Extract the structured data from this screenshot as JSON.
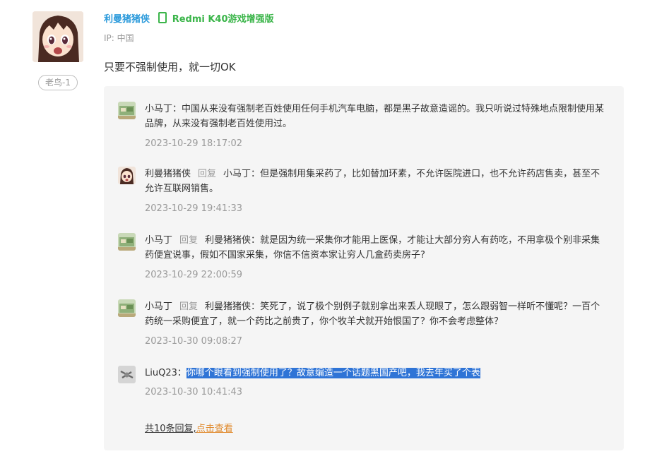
{
  "post": {
    "author": "利曼猪猪侠",
    "device": "Redmi K40游戏增强版",
    "device_icon": "phone-icon",
    "ip": "IP: 中国",
    "level": "老鸟-1",
    "content": "只要不强制使用，就一切OK"
  },
  "replies": [
    {
      "user": "小马丁",
      "separator": "：",
      "reply_word": "",
      "target": "",
      "text": "中国从来没有强制老百姓使用任何手机汽车电脑，都是黑子故意造谣的。我只听说过特殊地点限制使用某品牌，从来没有强制老百姓使用过。",
      "time": "2023-10-29 18:17:02"
    },
    {
      "user": "利曼猪猪侠",
      "separator": "：",
      "reply_word": "回复",
      "target": "小马丁",
      "text": "但是强制用集采药了，比如替加环素，不允许医院进口，也不允许药店售卖，甚至不允许互联网销售。",
      "time": "2023-10-29 19:41:33"
    },
    {
      "user": "小马丁",
      "separator": "：",
      "reply_word": "回复",
      "target": "利曼猪猪侠",
      "text": "就是因为统一采集你才能用上医保，才能让大部分穷人有药吃，不用拿极个别非采集药便宜说事，假如不国家采集，你信不信资本家让穷人几盒药卖房子?",
      "time": "2023-10-29 22:00:59"
    },
    {
      "user": "小马丁",
      "separator": "：",
      "reply_word": "回复",
      "target": "利曼猪猪侠",
      "text": "笑死了，说了极个别例子就别拿出来丢人现眼了，怎么跟弱智一样听不懂呢？一百个药统一采购便宜了，就一个药比之前贵了，你个牧羊犬就开始恨国了？你不会考虑整体？",
      "time": "2023-10-30 09:08:27"
    },
    {
      "user": "LiuQ23",
      "separator": "：",
      "reply_word": "",
      "target": "",
      "text": "你哪个眼看到强制使用了？故意编造一个话题黑国产吧，我去年买了个表",
      "time": "2023-10-30 10:41:43"
    }
  ],
  "more": {
    "total": "共10条回复,",
    "link": "点击查看"
  }
}
